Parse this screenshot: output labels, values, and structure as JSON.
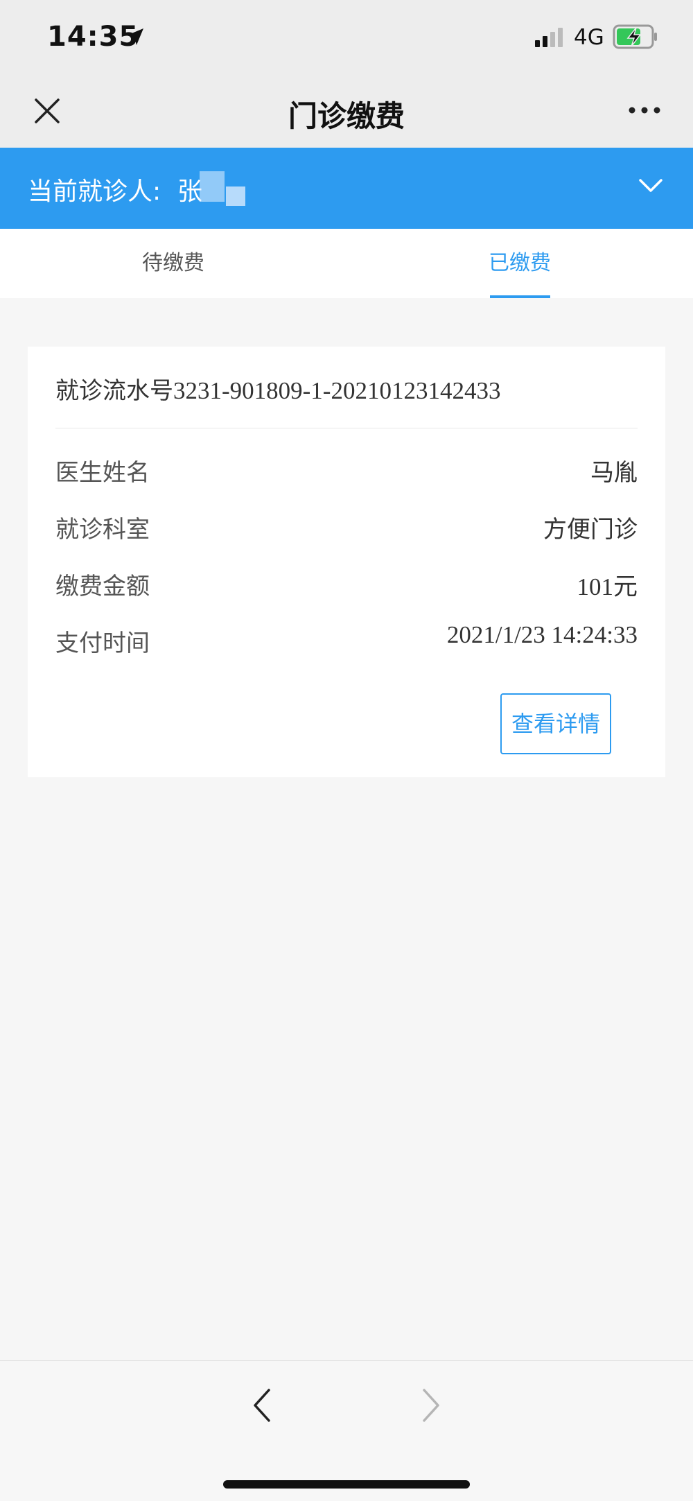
{
  "status_bar": {
    "time": "14:35",
    "network": "4G",
    "icons": [
      "location-arrow-icon",
      "signal-icon",
      "battery-charging-icon"
    ]
  },
  "nav": {
    "title": "门诊缴费",
    "close_icon": "close-icon",
    "more_icon": "more-icon"
  },
  "patient": {
    "label": "当前就诊人:",
    "name": "张",
    "dropdown_icon": "chevron-down-icon"
  },
  "tabs": [
    {
      "label": "待缴费",
      "active": false
    },
    {
      "label": "已缴费",
      "active": true
    }
  ],
  "record": {
    "serial_label": "就诊流水号",
    "serial_number": "3231-901809-1-20210123142433",
    "rows": [
      {
        "label": "医生姓名",
        "value": "马胤"
      },
      {
        "label": "就诊科室",
        "value": "方便门诊"
      },
      {
        "label": "缴费金额",
        "value": "101元"
      },
      {
        "label": "支付时间",
        "value": "2021/1/23 14:24:33"
      }
    ],
    "detail_button": "查看详情"
  },
  "bottom_bar": {
    "back_icon": "chevron-left-icon",
    "forward_icon": "chevron-right-icon"
  },
  "colors": {
    "accent": "#2d9bf0",
    "page_background": "#f6f6f6",
    "nav_background": "#ededed"
  }
}
